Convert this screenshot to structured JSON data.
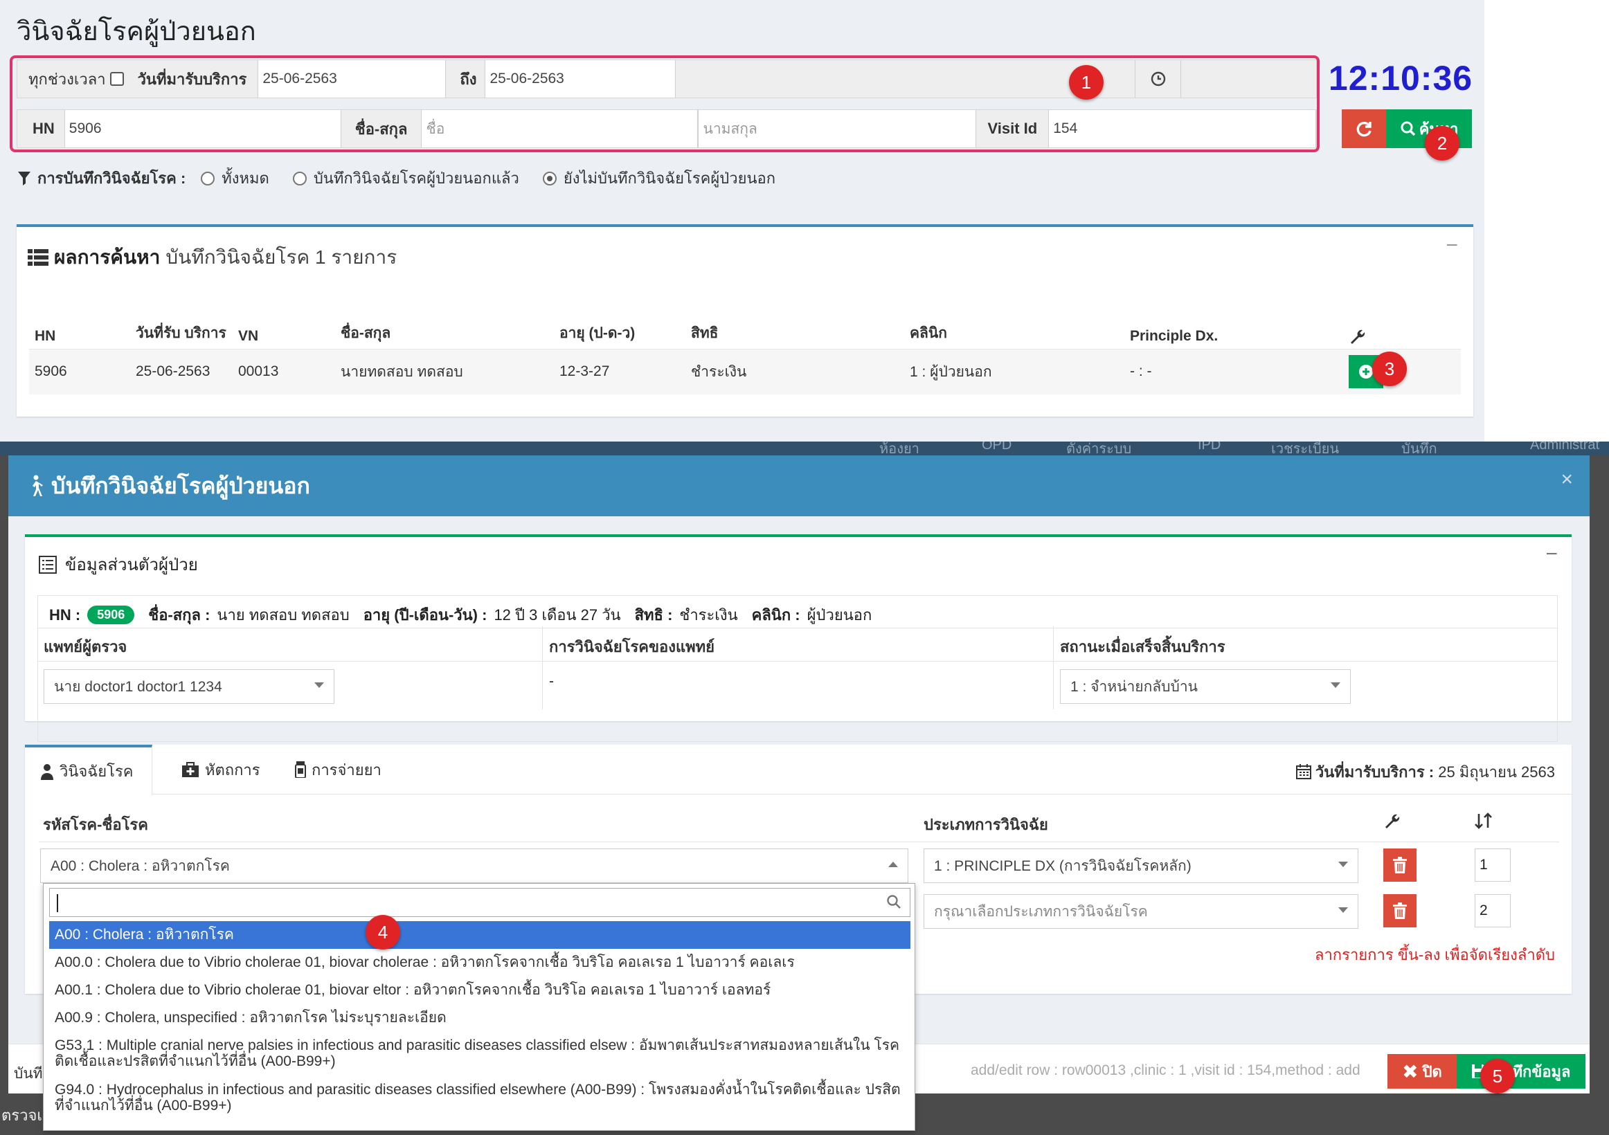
{
  "page": {
    "title": "วินิจฉัยโรคผู้ป่วยนอก",
    "clock": "12:10:36"
  },
  "search": {
    "all_time_label": "ทุกช่วงเวลา",
    "service_date_label": "วันที่มารับบริการ",
    "date_from": "25-06-2563",
    "to_label": "ถึง",
    "date_to": "25-06-2563",
    "hn_label": "HN",
    "hn_value": "5906",
    "name_label": "ชื่อ-สกุล",
    "first_name_placeholder": "ชื่อ",
    "last_name_placeholder": "นามสกุล",
    "visit_id_label": "Visit Id",
    "visit_id_value": "154",
    "search_button": "ค้นหา"
  },
  "diag_filter": {
    "label": "การบันทึกวินิจฉัยโรค :",
    "options": [
      "ทั้งหมด",
      "บันทึกวินิจฉัยโรคผู้ป่วยนอกแล้ว",
      "ยังไม่บันทึกวินิจฉัยโรคผู้ป่วยนอก"
    ],
    "selected": "ยังไม่บันทึกวินิจฉัยโรคผู้ป่วยนอก"
  },
  "results": {
    "heading": "ผลการค้นหา",
    "subheading": "บันทึกวินิจฉัยโรค 1 รายการ",
    "columns": [
      "HN",
      "วันที่รับ บริการ",
      "VN",
      "ชื่อ-สกุล",
      "อายุ (ป-ด-ว)",
      "สิทธิ",
      "คลินิก",
      "Principle Dx."
    ],
    "rows": [
      {
        "hn": "5906",
        "date": "25-06-2563",
        "vn": "00013",
        "name": "นายทดสอบ ทดสอบ",
        "age": "12-3-27",
        "right": "ชำระเงิน",
        "clinic": "1 : ผู้ป่วยนอก",
        "dx": "- : -"
      }
    ]
  },
  "badges": [
    "1",
    "2",
    "3",
    "4",
    "5"
  ],
  "nav_behind": [
    "ห้องยา",
    "OPD",
    "ตั้งค่าระบบ",
    "IPD",
    "เวชระเบียน",
    "บันทึก",
    "Administrat"
  ],
  "modal": {
    "title": "บันทึกวินิจฉัยโรคผู้ป่วยนอก",
    "patient_panel_title": "ข้อมูลส่วนตัวผู้ป่วย",
    "hn_label": "HN :",
    "hn": "5906",
    "name_label": "ชื่อ-สกุล :",
    "name": "นาย ทดสอบ ทดสอบ",
    "age_label": "อายุ (ปี-เดือน-วัน) :",
    "age": "12 ปี 3 เดือน 27 วัน",
    "right_label": "สิทธิ :",
    "right": "ชำระเงิน",
    "clinic_label": "คลินิก :",
    "clinic": "ผู้ป่วยนอก",
    "doctor_label": "แพทย์ผู้ตรวจ",
    "doctor": "นาย doctor1 doctor1 1234",
    "doctor_dx_label": "การวินิจฉัยโรคของแพทย์",
    "doctor_dx": "-",
    "discharge_label": "สถานะเมื่อเสร็จสิ้นบริการ",
    "discharge": "1 : จำหน่ายกลับบ้าน",
    "tabs": [
      "วินิจฉัยโรค",
      "หัตถการ",
      "การจ่ายยา"
    ],
    "visit_date_label": "วันที่มารับบริการ :",
    "visit_date": "25 มิถุนายน 2563",
    "code_col": "รหัสโรค-ชื่อโรค",
    "type_col": "ประเภทการวินิจฉัย",
    "dx_rows": [
      {
        "code": "A00 : Cholera : อหิวาตกโรค",
        "type": "1 : PRINCIPLE DX (การวินิจฉัยโรคหลัก)",
        "order": "1"
      },
      {
        "code": "",
        "type": "กรุณาเลือกประเภทการวินิจฉัยโรค",
        "order": "2"
      }
    ],
    "drag_hint": "ลากรายการ ขึ้น-ลง เพื่อจัดเรียงลำดับ",
    "dropdown_options": [
      "A00 : Cholera : อหิวาตกโรค",
      "A00.0 : Cholera due to Vibrio cholerae 01, biovar cholerae : อหิวาตกโรคจากเชื้อ วิบริโอ คอเลเรอ 1 ไบอาวาร์ คอเลเร",
      "A00.1 : Cholera due to Vibrio cholerae 01, biovar eltor : อหิวาตกโรคจากเชื้อ วิบริโอ คอเลเรอ 1 ไบอาวาร์ เอลทอร์",
      "A00.9 : Cholera, unspecified : อหิวาตกโรค ไม่ระบุรายละเอียด",
      "G53.1 : Multiple cranial nerve palsies in infectious and parasitic diseases classified elsew : อัมพาตเส้นประสาทสมองหลายเส้นใน โรคติดเชื้อและปรสิตที่จำแนกไว้ที่อื่น (A00-B99+)",
      "G94.0 : Hydrocephalus in infectious and parasitic diseases classified elsewhere (A00-B99) : โพรงสมองคั่งน้ำในโรคติดเชื้อและ ปรสิตที่จำแนกไว้ที่อื่น (A00-B99+)"
    ],
    "footer_info": "add/edit row : row00013 ,clinic : 1 ,visit id : 154,method : add",
    "footer_left": "บันที",
    "close_button": "ปิด",
    "save_button": "บันทึกข้อมูล"
  },
  "bottom_left": "ตรวจเ",
  "colors": {
    "primary": "#3c8dbc",
    "success": "#00a65a",
    "danger": "#dd4b39",
    "highlight": "#e0336a",
    "clock": "#1f1fd0"
  }
}
